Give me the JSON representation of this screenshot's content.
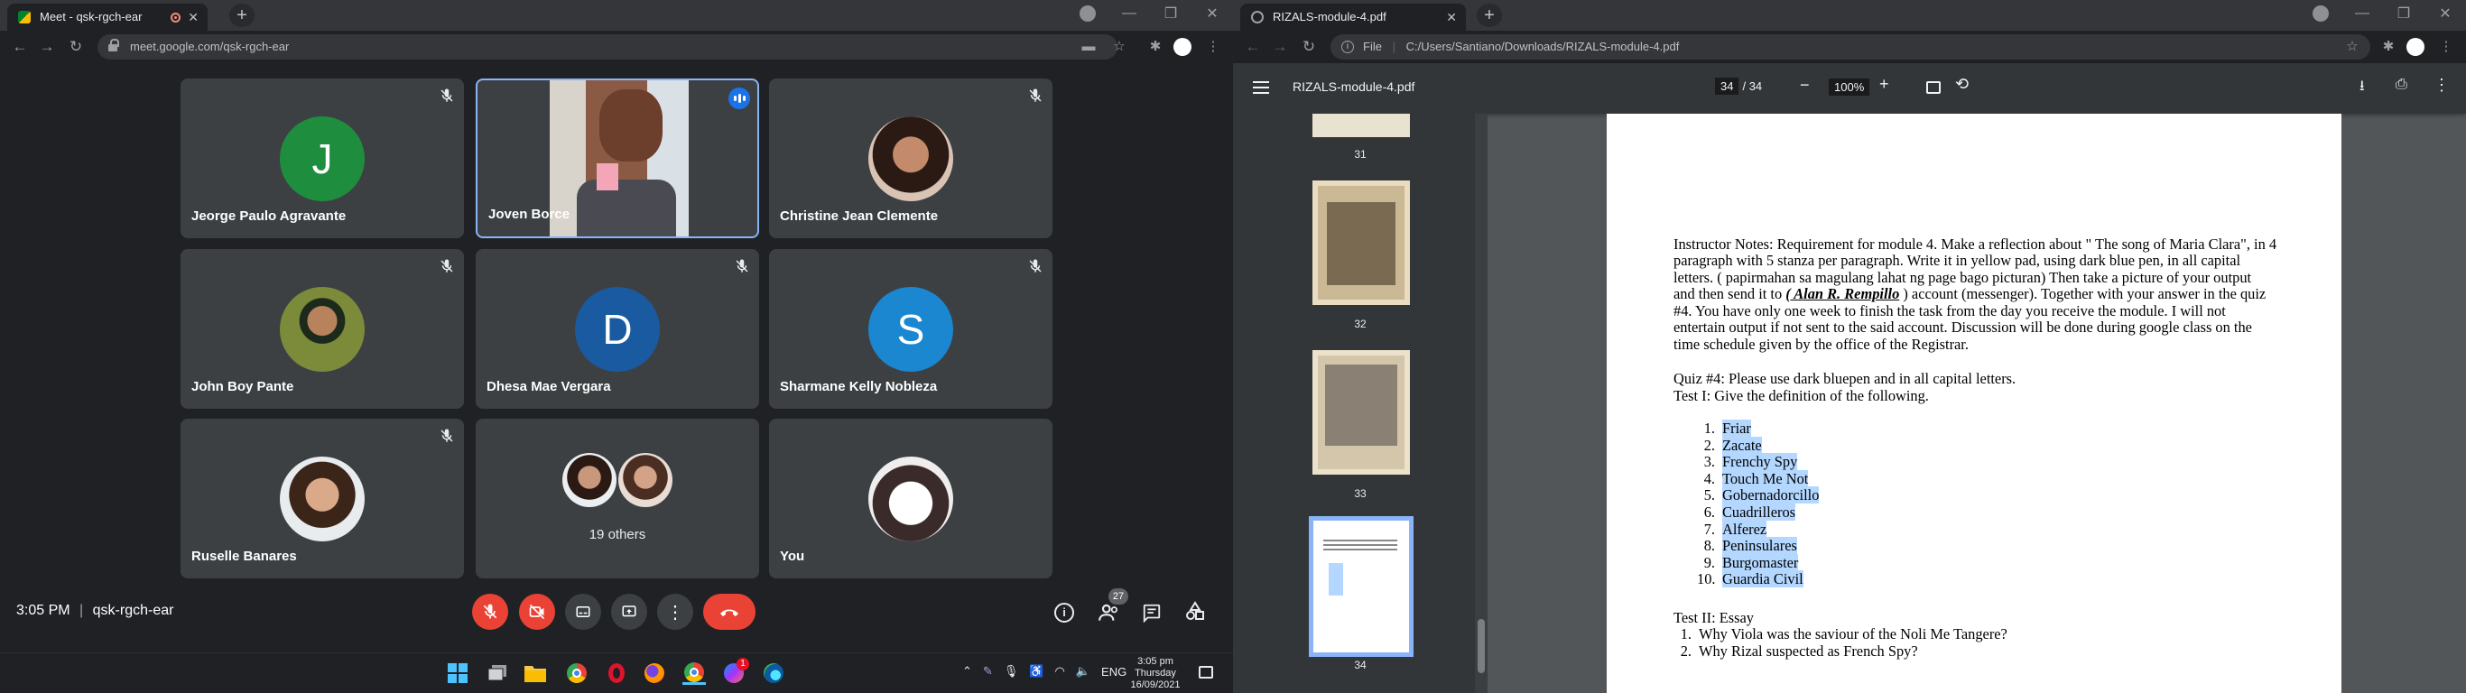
{
  "meet": {
    "tab_title": "Meet - qsk-rgch-ear",
    "url": "meet.google.com/qsk-rgch-ear",
    "participants": [
      {
        "name": "Jeorge Paulo Agravante",
        "initial": "J",
        "avatar_color": "#1e8e3e"
      },
      {
        "name": "Joven Borce",
        "speaking": true
      },
      {
        "name": "Christine Jean Clemente"
      },
      {
        "name": "John Boy Pante"
      },
      {
        "name": "Dhesa Mae Vergara",
        "initial": "D",
        "avatar_color": "#1a5aa0"
      },
      {
        "name": "Sharmane Kelly Nobleza",
        "initial": "S",
        "avatar_color": "#1a87d0"
      },
      {
        "name": "Ruselle Banares"
      },
      {
        "name": "19 others"
      },
      {
        "name": "You"
      }
    ],
    "time": "3:05 PM",
    "separator": "|",
    "meeting_code": "qsk-rgch-ear",
    "people_count": "27",
    "accent_red": "#ea4335"
  },
  "taskbar": {
    "time": "3:05 pm",
    "day": "Thursday",
    "date": "16/09/2021",
    "lang": "ENG",
    "messenger_badge": "1"
  },
  "pdf": {
    "tab_title": "RIZALS-module-4.pdf",
    "url_scheme": "File",
    "url_sep": "|",
    "url": "C:/Users/Santiano/Downloads/RIZALS-module-4.pdf",
    "file_name": "RIZALS-module-4.pdf",
    "page_current": "34",
    "page_total": "/ 34",
    "zoom": "100%",
    "thumbs": [
      "31",
      "32",
      "33",
      "34"
    ],
    "notes_lines": [
      "Instructor Notes:  Requirement for module 4.  Make a reflection about \" The song of Maria Clara\", in 4",
      "paragraph with 5 stanza per paragraph.  Write it in yellow pad, using dark blue pen, in all capital",
      "letters.  ( papirmahan sa magulang lahat ng page bago picturan) Then take a picture of your output",
      "and  then send it to ",
      "( Alan R. Rempillo",
      " ) account (messenger). Together with your answer in the quiz",
      "#4.  You have only one week to finish the task from the day you receive the module.  I will not",
      "entertain output if not sent to the said account. Discussion will be done during google class on the",
      "time schedule given by the office of the Registrar."
    ],
    "quiz_line": "Quiz #4:  Please use dark bluepen and in all capital letters.",
    "test1_line": "Test I:  Give the definition of the following.",
    "terms": [
      {
        "n": "1.",
        "t": "Friar"
      },
      {
        "n": "2.",
        "t": "Zacate"
      },
      {
        "n": "3.",
        "t": "Frenchy Spy"
      },
      {
        "n": "4.",
        "t": "Touch Me Not"
      },
      {
        "n": "5.",
        "t": "Gobernadorcillo"
      },
      {
        "n": "6.",
        "t": "Cuadrilleros"
      },
      {
        "n": "7.",
        "t": "Alferez"
      },
      {
        "n": "8.",
        "t": "Peninsulares"
      },
      {
        "n": "9.",
        "t": "Burgomaster"
      },
      {
        "n": "10.",
        "t": "Guardia Civil"
      }
    ],
    "test2_line": "Test II:  Essay",
    "essay": [
      {
        "n": "1.",
        "t": "Why Viola was the saviour of the Noli Me Tangere?"
      },
      {
        "n": "2.",
        "t": "Why Rizal suspected as French Spy?"
      }
    ]
  }
}
